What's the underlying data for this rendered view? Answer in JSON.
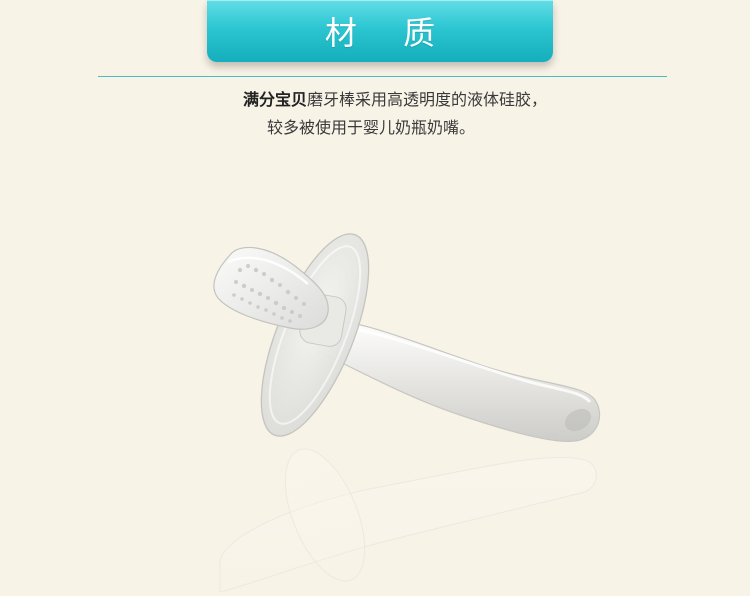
{
  "title": "材 质",
  "description": {
    "brand": "满分宝贝",
    "line1_rest": "磨牙棒采用高透明度的液体硅胶，",
    "line2": "较多被使用于婴儿奶瓶奶嘴。"
  },
  "image": {
    "subject": "transparent silicone teether",
    "icon": "teether-product-image"
  },
  "colors": {
    "background": "#f8f3e7",
    "banner": "#2cc6d2",
    "divider": "#4fb9c2",
    "text": "#3a3a3a"
  }
}
